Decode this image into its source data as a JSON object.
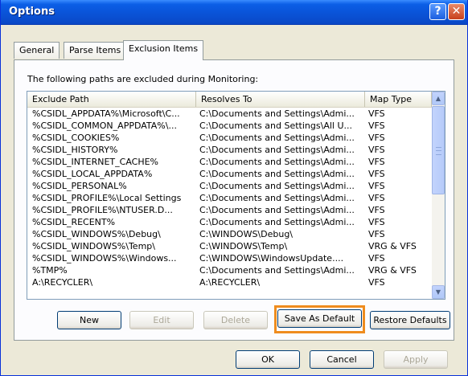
{
  "window": {
    "title": "Options"
  },
  "title_buttons": {
    "help": "?",
    "close": "✕"
  },
  "tabs": [
    {
      "label": "General"
    },
    {
      "label": "Parse Items"
    },
    {
      "label": "Exclusion Items"
    }
  ],
  "panel": {
    "intro": "The following paths are excluded during Monitoring:"
  },
  "list": {
    "columns": [
      "Exclude Path",
      "Resolves To",
      "Map Type"
    ],
    "rows": [
      [
        "%CSIDL_APPDATA%\\Microsoft\\C...",
        "C:\\Documents and Settings\\Admi...",
        "VFS"
      ],
      [
        "%CSIDL_COMMON_APPDATA%\\...",
        "C:\\Documents and Settings\\All U...",
        "VFS"
      ],
      [
        "%CSIDL_COOKIES%",
        "C:\\Documents and Settings\\Admi...",
        "VFS"
      ],
      [
        "%CSIDL_HISTORY%",
        "C:\\Documents and Settings\\Admi...",
        "VFS"
      ],
      [
        "%CSIDL_INTERNET_CACHE%",
        "C:\\Documents and Settings\\Admi...",
        "VFS"
      ],
      [
        "%CSIDL_LOCAL_APPDATA%",
        "C:\\Documents and Settings\\Admi...",
        "VFS"
      ],
      [
        "%CSIDL_PERSONAL%",
        "C:\\Documents and Settings\\Admi...",
        "VFS"
      ],
      [
        "%CSIDL_PROFILE%\\Local Settings",
        "C:\\Documents and Settings\\Admi...",
        "VFS"
      ],
      [
        "%CSIDL_PROFILE%\\NTUSER.D...",
        "C:\\Documents and Settings\\Admi...",
        "VFS"
      ],
      [
        "%CSIDL_RECENT%",
        "C:\\Documents and Settings\\Admi...",
        "VFS"
      ],
      [
        "%CSIDL_WINDOWS%\\Debug\\",
        "C:\\WINDOWS\\Debug\\",
        "VFS"
      ],
      [
        "%CSIDL_WINDOWS%\\Temp\\",
        "C:\\WINDOWS\\Temp\\",
        "VRG & VFS"
      ],
      [
        "%CSIDL_WINDOWS%\\Windows...",
        "C:\\WINDOWS\\WindowsUpdate....",
        "VFS"
      ],
      [
        "%TMP%",
        "C:\\Documents and Settings\\Admi...",
        "VRG & VFS"
      ],
      [
        "A:\\RECYCLER\\",
        "A:\\RECYCLER\\",
        "VFS"
      ]
    ]
  },
  "scrollbar": {
    "up": "▲",
    "down": "▼"
  },
  "buttons": {
    "new": "New",
    "edit": "Edit",
    "delete": "Delete",
    "save_default": "Save As Default",
    "restore_defaults": "Restore Defaults",
    "ok": "OK",
    "cancel": "Cancel",
    "apply": "Apply"
  },
  "colors": {
    "titlebar": "#0a52d6",
    "highlight": "#ef8c1e",
    "dialog": "#ece9d8"
  }
}
